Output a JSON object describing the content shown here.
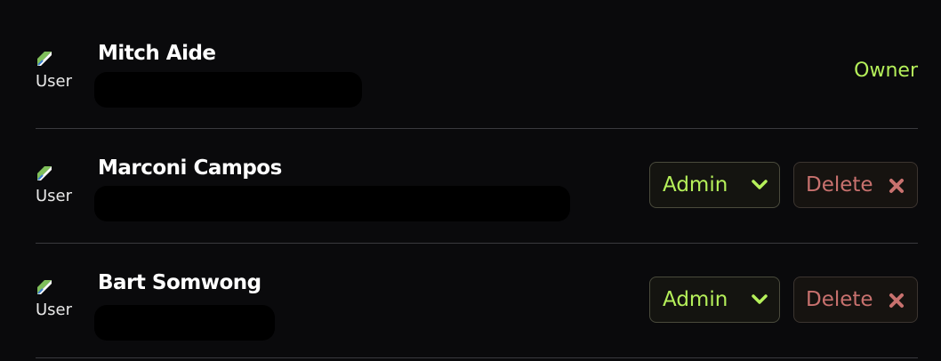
{
  "members": [
    {
      "name": "Mitch Aide",
      "avatar_alt": "User",
      "role_label": "Owner",
      "email_redacted": true
    },
    {
      "name": "Marconi Campos",
      "avatar_alt": "User",
      "role_select_value": "Admin",
      "delete_label": "Delete",
      "email_redacted": true
    },
    {
      "name": "Bart Somwong",
      "avatar_alt": "User",
      "role_select_value": "Admin",
      "delete_label": "Delete",
      "email_redacted": true
    }
  ],
  "colors": {
    "background": "#0a0a0c",
    "accent": "#b5f05a",
    "danger": "#c8716e",
    "divider": "#3a3a3e"
  },
  "icons": {
    "avatar": "broken-image-icon",
    "role_dropdown": "chevron-down-icon",
    "delete": "close-icon"
  }
}
